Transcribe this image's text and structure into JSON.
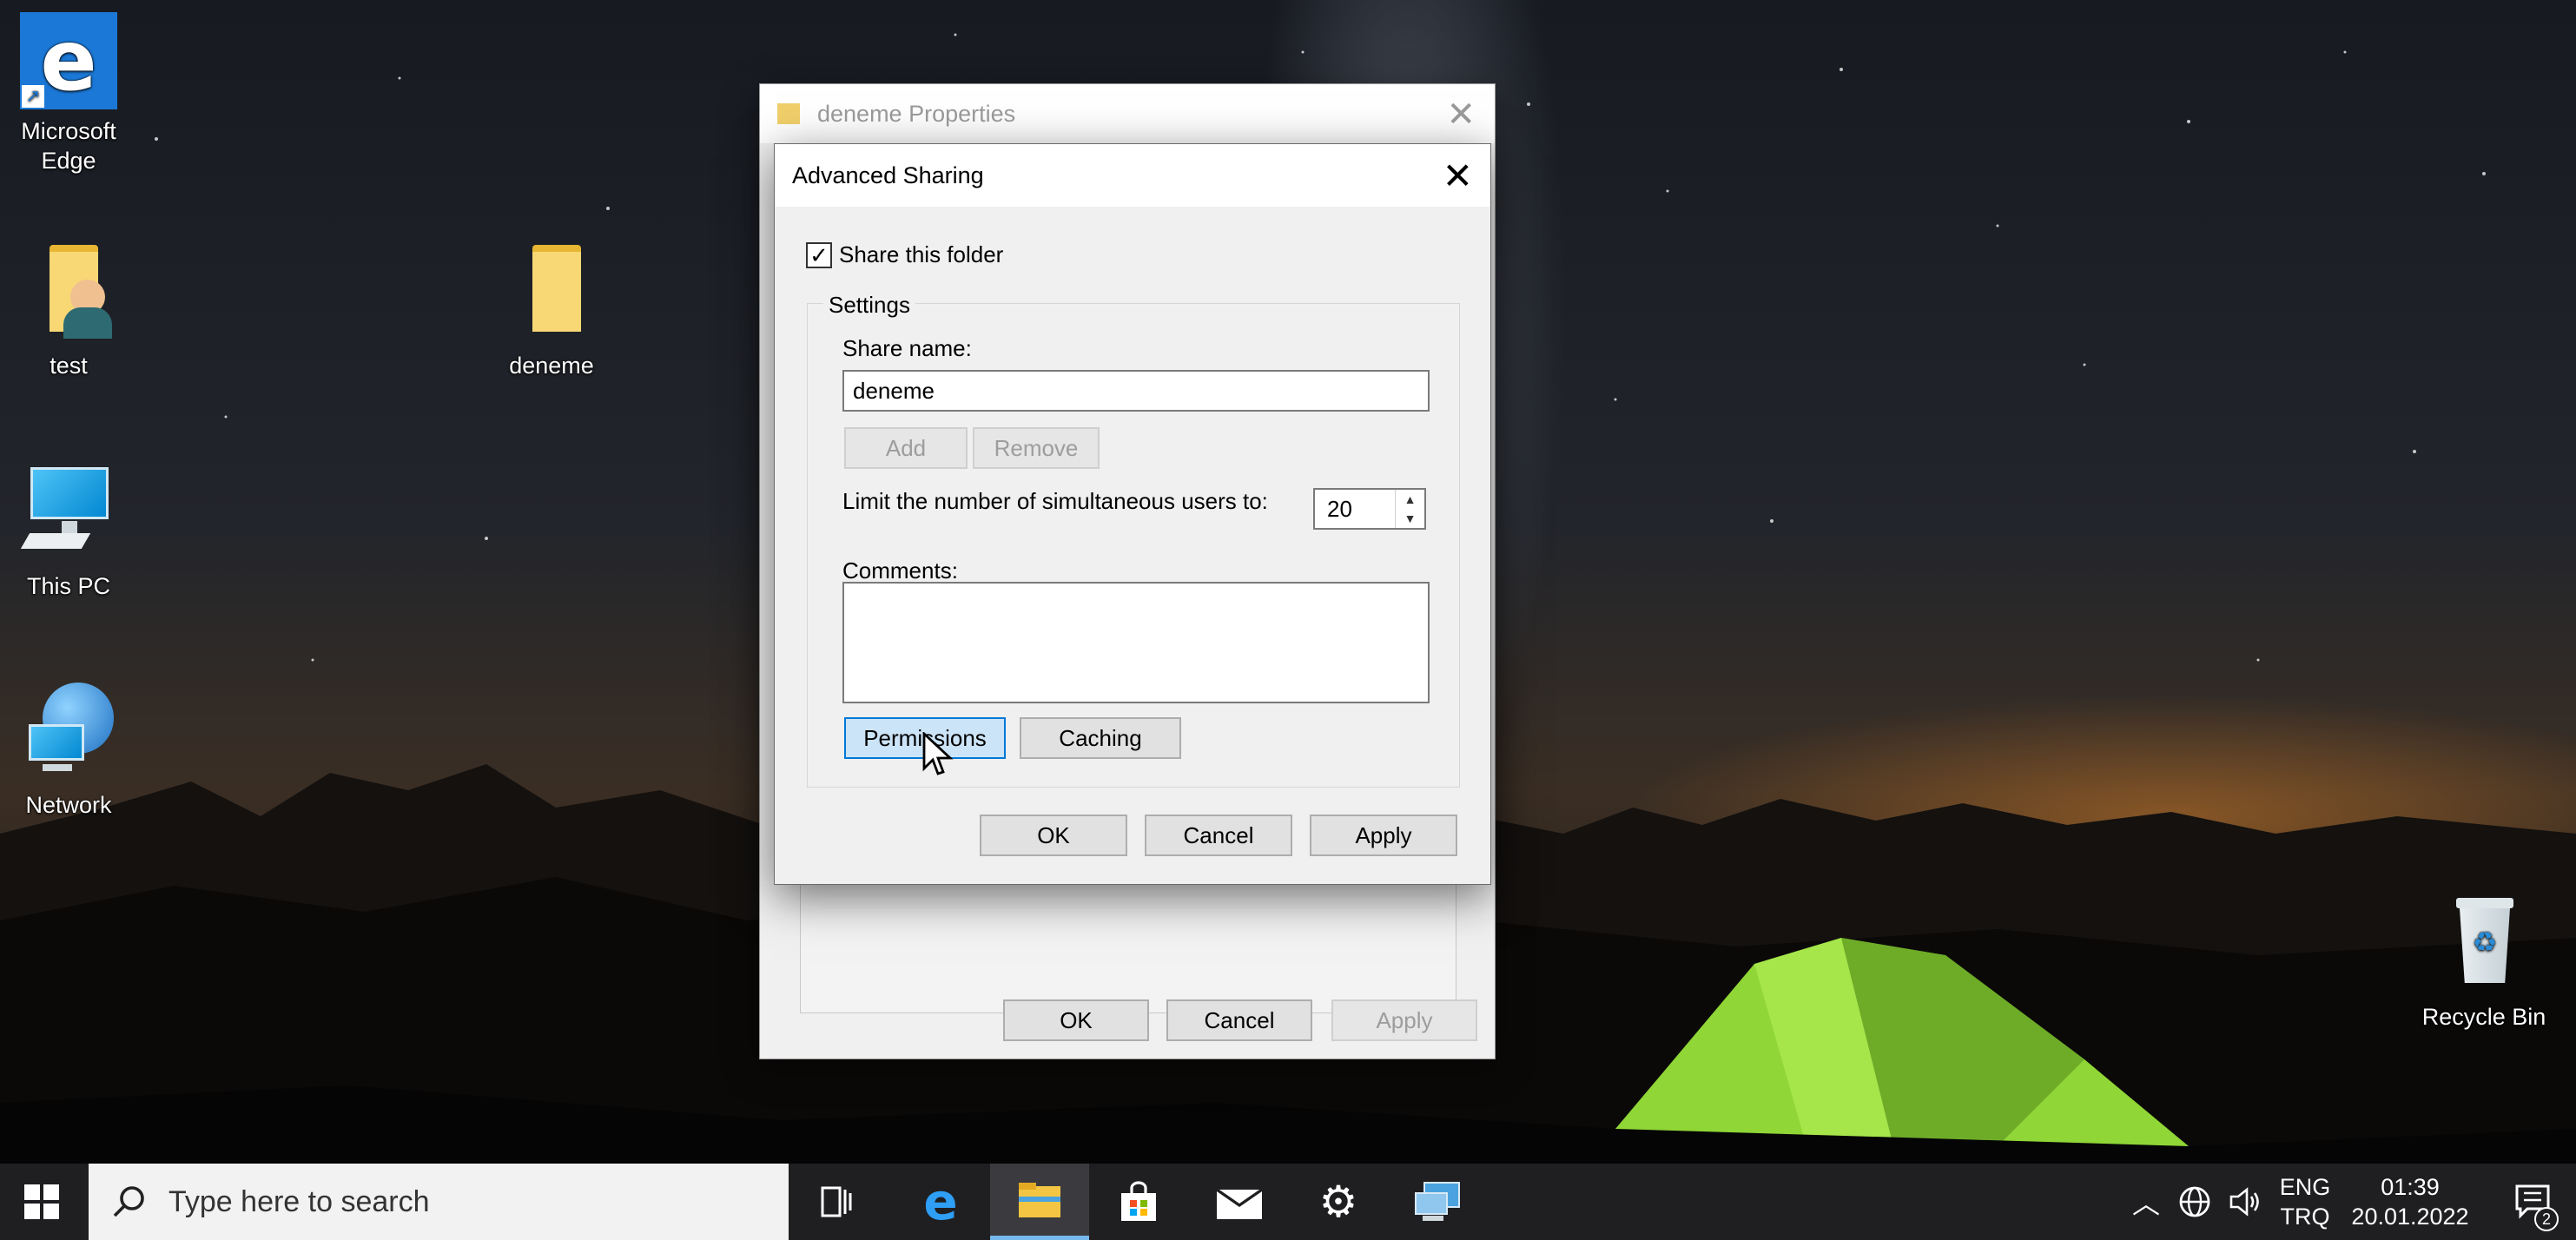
{
  "desktop": {
    "icons": [
      {
        "label_line1": "Microsoft",
        "label_line2": "Edge"
      },
      {
        "label": "test"
      },
      {
        "label": "deneme"
      },
      {
        "label": "This PC"
      },
      {
        "label": "Network"
      },
      {
        "label": "Recycle Bin"
      }
    ]
  },
  "properties_window": {
    "title": "deneme Properties",
    "ok_label": "OK",
    "cancel_label": "Cancel",
    "apply_label": "Apply"
  },
  "advanced_sharing": {
    "title": "Advanced Sharing",
    "share_checkbox_label": "Share this folder",
    "share_checked": true,
    "settings_legend": "Settings",
    "share_name_label": "Share name:",
    "share_name_value": "deneme",
    "add_label": "Add",
    "remove_label": "Remove",
    "limit_label": "Limit the number of simultaneous users to:",
    "limit_value": "20",
    "comments_label": "Comments:",
    "comments_value": "",
    "permissions_label": "Permissions",
    "caching_label": "Caching",
    "ok_label": "OK",
    "cancel_label": "Cancel",
    "apply_label": "Apply"
  },
  "taskbar": {
    "search_placeholder": "Type here to search",
    "apps": [
      "task-view-icon",
      "edge-icon",
      "file-explorer-icon",
      "store-icon",
      "mail-icon",
      "settings-icon",
      "remote-desktop-icon"
    ],
    "language_line1": "ENG",
    "language_line2": "TRQ",
    "time": "01:39",
    "date": "20.01.2022",
    "notification_count": "2"
  },
  "colors": {
    "accent_blue": "#0078d7",
    "selected_button": "#cce4f7",
    "tent_green": "#8fd636"
  }
}
